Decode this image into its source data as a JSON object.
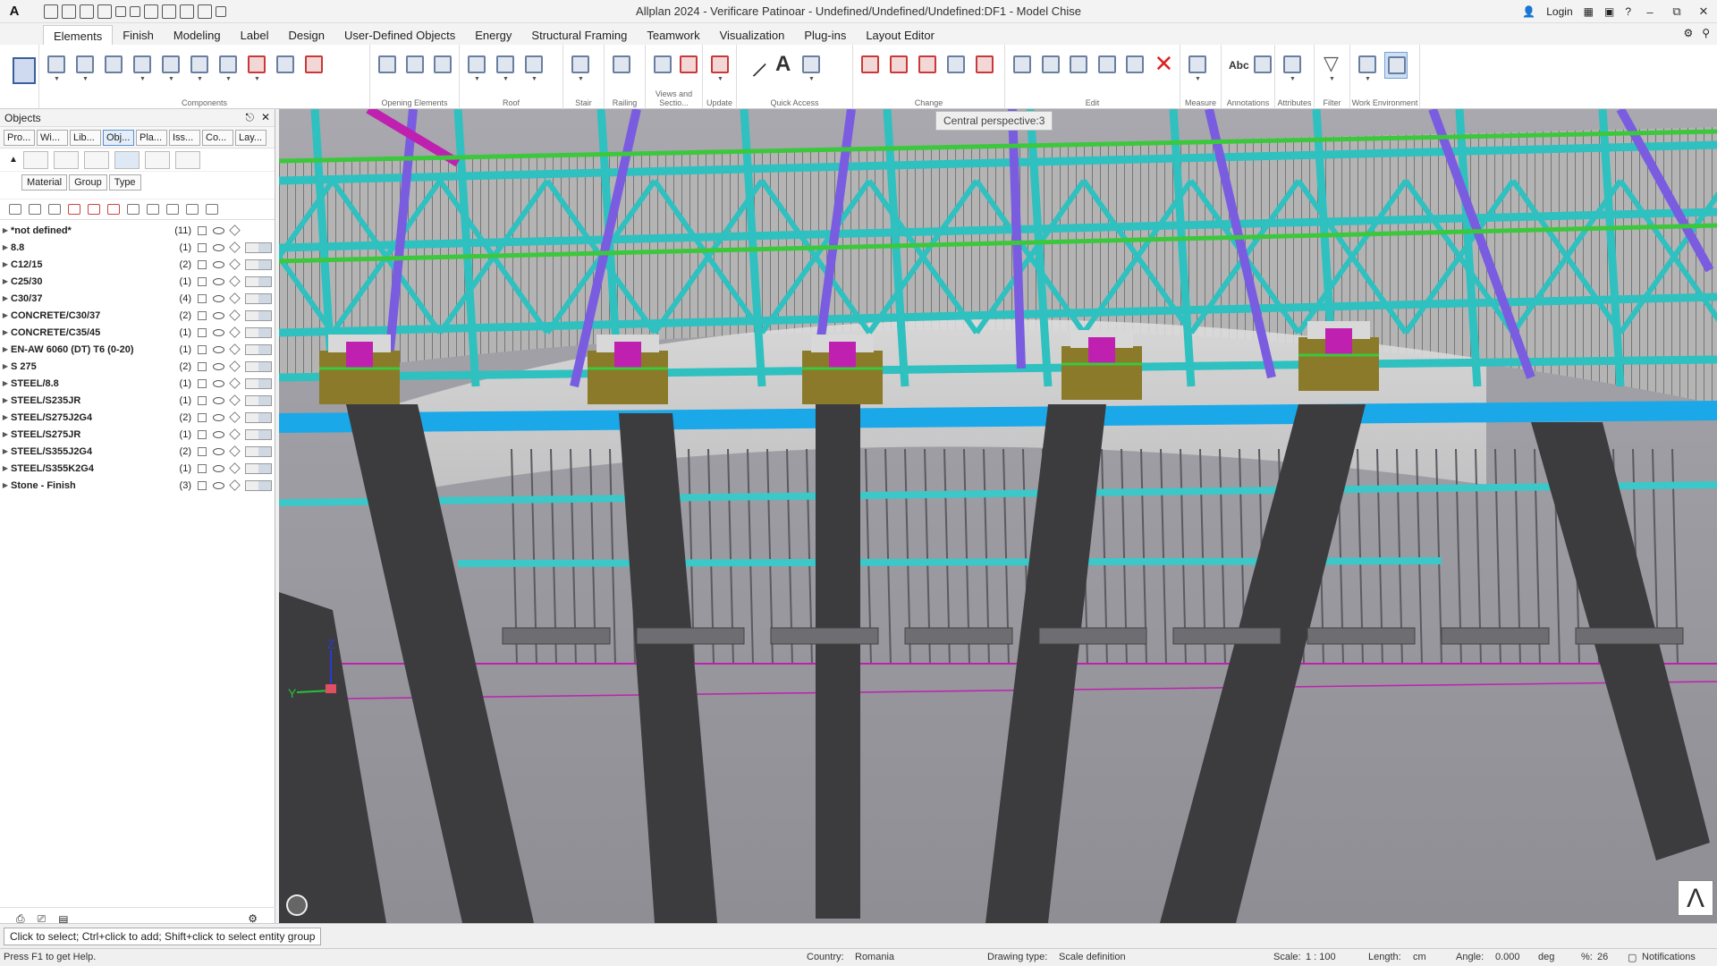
{
  "titlebar": {
    "logo": "A",
    "title": "Allplan 2024 - Verificare Patinoar - Undefined/Undefined/Undefined:DF1 - Model Chise",
    "login": "Login"
  },
  "ribbon": {
    "tabs": [
      "Elements",
      "Finish",
      "Modeling",
      "Label",
      "Design",
      "User-Defined Objects",
      "Energy",
      "Structural Framing",
      "Teamwork",
      "Visualization",
      "Plug-ins",
      "Layout Editor"
    ],
    "groups": [
      "Components",
      "Opening Elements",
      "Roof",
      "Stair",
      "Railing",
      "Views and Sectio...",
      "Update",
      "Quick Access",
      "Change",
      "Edit",
      "Measure",
      "Annotations",
      "Attributes",
      "Filter",
      "Work Environment"
    ],
    "quick_access_text": "A",
    "annotations_text": "Abc"
  },
  "panel": {
    "title": "Objects",
    "tabs": [
      "Pro...",
      "Wi...",
      "Lib...",
      "Obj...",
      "Pla...",
      "Iss...",
      "Co...",
      "Lay..."
    ],
    "filters": [
      "Material",
      "Group",
      "Type"
    ],
    "items": [
      {
        "name": "*not defined*",
        "count": "(11)"
      },
      {
        "name": "8.8",
        "count": "(1)"
      },
      {
        "name": "C12/15",
        "count": "(2)"
      },
      {
        "name": "C25/30",
        "count": "(1)"
      },
      {
        "name": "C30/37",
        "count": "(4)"
      },
      {
        "name": "CONCRETE/C30/37",
        "count": "(2)"
      },
      {
        "name": "CONCRETE/C35/45",
        "count": "(1)"
      },
      {
        "name": "EN-AW 6060 (DT) T6 (0-20)",
        "count": "(1)"
      },
      {
        "name": "S 275",
        "count": "(2)"
      },
      {
        "name": "STEEL/8.8",
        "count": "(1)"
      },
      {
        "name": "STEEL/S235JR",
        "count": "(1)"
      },
      {
        "name": "STEEL/S275J2G4",
        "count": "(2)"
      },
      {
        "name": "STEEL/S275JR",
        "count": "(1)"
      },
      {
        "name": "STEEL/S355J2G4",
        "count": "(2)"
      },
      {
        "name": "STEEL/S355K2G4",
        "count": "(1)"
      },
      {
        "name": "Stone - Finish",
        "count": "(3)"
      }
    ]
  },
  "viewport": {
    "label": "Central perspective:3",
    "axis_z": "Z",
    "axis_y": "Y",
    "nav_cube": "Λ",
    "colors": {
      "background": "#9a9aa0",
      "truss": "#2fc0c0",
      "purlin": "#7a5ce0",
      "beam": "#1aa8e8",
      "column": "#3c3c3e",
      "green": "#3cc83c",
      "magenta": "#c020b0"
    }
  },
  "cmdline": {
    "message": "Click to select; Ctrl+click to add; Shift+click to select entity group"
  },
  "status": {
    "help": "Press F1 to get Help.",
    "country_label": "Country:",
    "country": "Romania",
    "drawing_type_label": "Drawing type:",
    "drawing_type": "Scale definition",
    "scale_label": "Scale:",
    "scale": "1 : 100",
    "length_label": "Length:",
    "length": "cm",
    "angle_label": "Angle:",
    "angle": "0.000",
    "angle_unit": "deg",
    "percent_label": "%:",
    "percent": "26",
    "notifications": "Notifications"
  }
}
